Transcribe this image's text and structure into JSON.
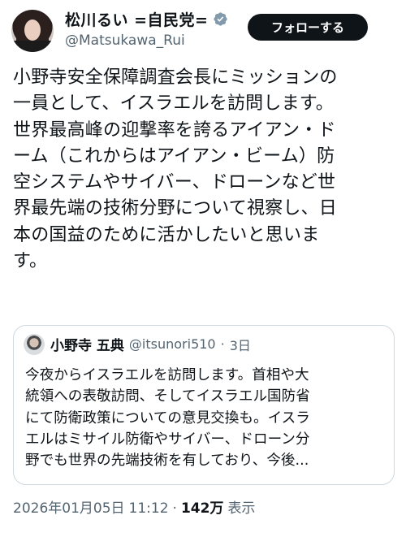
{
  "author": {
    "display_name": "松川るい =自民党=",
    "handle": "@Matsukawa_Rui",
    "verified_icon": "verified-badge-icon"
  },
  "follow_button": {
    "label": "フォローする"
  },
  "tweet": {
    "lines": [
      "小野寺安全保障調査会長にミッションの",
      "一員として、イスラエルを訪問します。",
      "世界最高峰の迎撃率を誇るアイアン・ド",
      "ーム（これからはアイアン・ビーム）防",
      "空システムやサイバー、ドローンなど世",
      "界最先端の技術分野について視察し、日",
      "本の国益のために活かしたいと思いま",
      "す。"
    ]
  },
  "quoted_tweet": {
    "display_name": "小野寺 五典",
    "handle": "@itsunori510",
    "separator": "·",
    "time": "3日",
    "lines": [
      "今夜からイスラエルを訪問します。首相や大",
      "統領への表敬訪問、そしてイスラエル国防省",
      "にて防衛政策についての意見交換も。イスラ",
      "エルはミサイル防衛やサイバー、ドローン分",
      "野でも世界の先端技術を有しており、今後..."
    ]
  },
  "meta": {
    "date": "2026年01月05日",
    "time": "11:12",
    "separator": "·",
    "views_count": "142万",
    "views_label": "表示"
  },
  "colors": {
    "primary_text": "#0f1419",
    "secondary_text": "#536471",
    "verified_badge": "#829aab",
    "button_bg": "#0f1419",
    "border": "#cfd9de"
  }
}
